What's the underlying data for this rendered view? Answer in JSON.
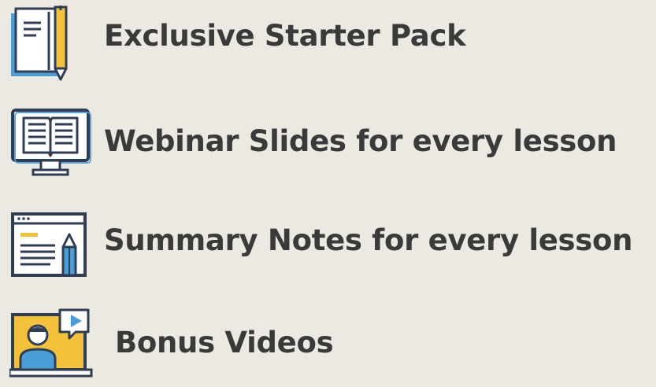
{
  "items": [
    {
      "label": "Exclusive Starter Pack",
      "icon": "book-pencil-icon"
    },
    {
      "label": "Webinar Slides for every lesson",
      "icon": "monitor-book-icon"
    },
    {
      "label": "Summary Notes for every lesson",
      "icon": "notes-window-pencil-icon"
    },
    {
      "label": "Bonus Videos",
      "icon": "video-presenter-icon"
    }
  ],
  "colors": {
    "background": "#ebe9e2",
    "text": "#3a3a3a",
    "icon_outline": "#2f3e55",
    "icon_blue": "#4a9fd8",
    "icon_yellow": "#f4c13a",
    "icon_white": "#ffffff"
  }
}
